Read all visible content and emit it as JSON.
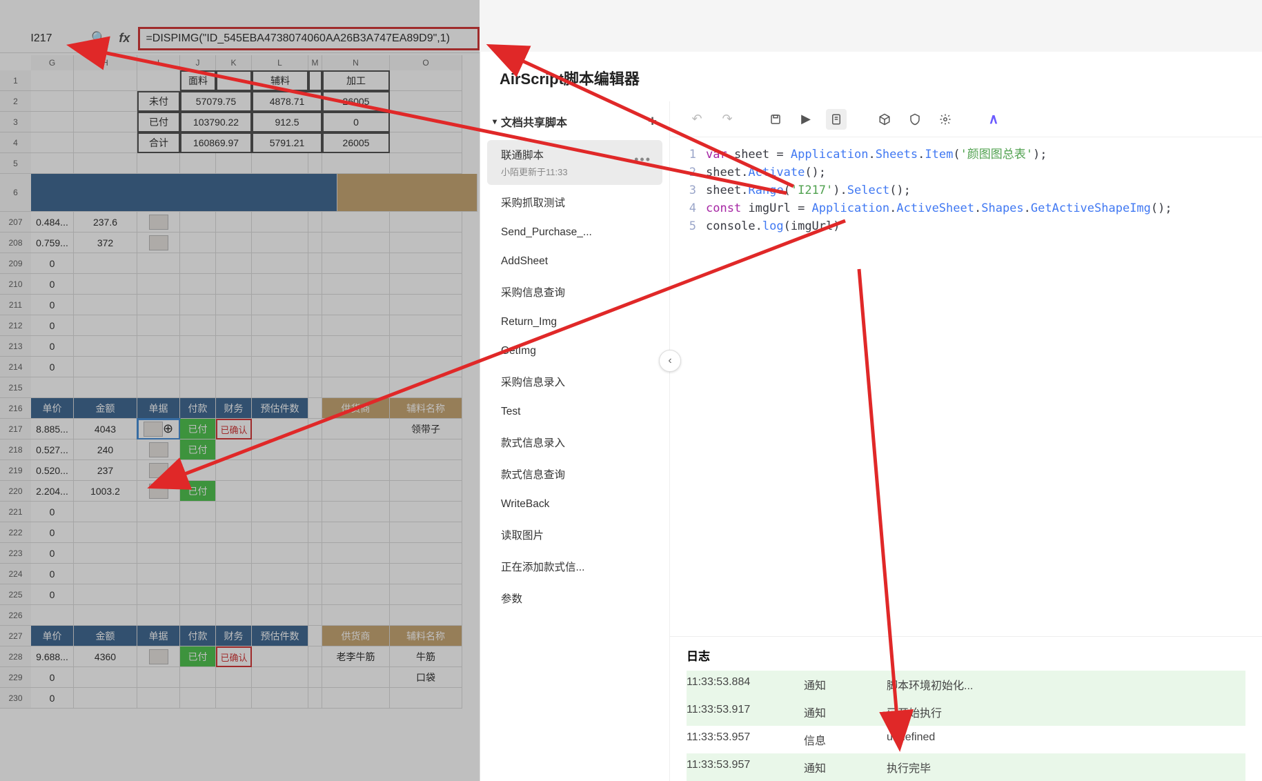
{
  "formula": {
    "cellRef": "I217",
    "value": "=DISPIMG(\"ID_545EBA4738074060AA26B3A747EA89D9\",1)"
  },
  "colHeaders": [
    "G",
    "H",
    "I",
    "J",
    "K",
    "L",
    "M",
    "N",
    "O"
  ],
  "topTable": {
    "hdr": [
      "面料",
      "辅料",
      "加工"
    ],
    "rows": [
      {
        "label": "未付",
        "vals": [
          "57079.75",
          "4878.71",
          "26005"
        ]
      },
      {
        "label": "已付",
        "vals": [
          "103790.22",
          "912.5",
          "0"
        ]
      },
      {
        "label": "合计",
        "vals": [
          "160869.97",
          "5791.21",
          "26005"
        ]
      }
    ]
  },
  "rowsA": {
    "nums": [
      "207",
      "208",
      "209",
      "210",
      "211",
      "212",
      "213",
      "214",
      "215"
    ],
    "data": [
      [
        "0.484...",
        "237.6",
        "img"
      ],
      [
        "0.759...",
        "372",
        "img"
      ],
      [
        "0",
        "",
        "",
        ""
      ],
      [
        "0",
        "",
        "",
        ""
      ],
      [
        "0",
        "",
        "",
        ""
      ],
      [
        "0",
        "",
        "",
        ""
      ],
      [
        "0",
        "",
        "",
        ""
      ],
      [
        "0",
        "",
        "",
        ""
      ],
      [
        "",
        "",
        "",
        ""
      ]
    ]
  },
  "section1": {
    "hdrRow": "216",
    "hdr": [
      "单价",
      "金额",
      "单据",
      "付款",
      "财务",
      "预估件数",
      "",
      "供货商",
      "辅料名称"
    ],
    "rows": [
      {
        "n": "217",
        "cells": [
          "8.885...",
          "4043",
          "img-sel",
          "已付",
          "已确认",
          "",
          "",
          "",
          "领带子"
        ]
      },
      {
        "n": "218",
        "cells": [
          "0.527...",
          "240",
          "img",
          "已付",
          "",
          "",
          "",
          "",
          ""
        ]
      },
      {
        "n": "219",
        "cells": [
          "0.520...",
          "237",
          "img",
          "",
          "",
          "",
          "",
          "",
          ""
        ]
      },
      {
        "n": "220",
        "cells": [
          "2.204...",
          "1003.2",
          "img",
          "已付",
          "",
          "",
          "",
          "",
          ""
        ]
      },
      {
        "n": "221",
        "cells": [
          "0",
          "",
          "",
          "",
          "",
          "",
          "",
          "",
          ""
        ]
      },
      {
        "n": "222",
        "cells": [
          "0",
          "",
          "",
          "",
          "",
          "",
          "",
          "",
          ""
        ]
      },
      {
        "n": "223",
        "cells": [
          "0",
          "",
          "",
          "",
          "",
          "",
          "",
          "",
          ""
        ]
      },
      {
        "n": "224",
        "cells": [
          "0",
          "",
          "",
          "",
          "",
          "",
          "",
          "",
          ""
        ]
      },
      {
        "n": "225",
        "cells": [
          "0",
          "",
          "",
          "",
          "",
          "",
          "",
          "",
          ""
        ]
      },
      {
        "n": "226",
        "cells": [
          "",
          "",
          "",
          "",
          "",
          "",
          "",
          "",
          ""
        ]
      }
    ]
  },
  "section2": {
    "hdrRow": "227",
    "hdr": [
      "单价",
      "金额",
      "单据",
      "付款",
      "财务",
      "预估件数",
      "",
      "供货商",
      "辅料名称"
    ],
    "rows": [
      {
        "n": "228",
        "cells": [
          "9.688...",
          "4360",
          "img",
          "已付",
          "已确认",
          "",
          "",
          "老李牛筋",
          "牛筋"
        ]
      },
      {
        "n": "229",
        "cells": [
          "0",
          "",
          "",
          "",
          "",
          "",
          "",
          "",
          "口袋"
        ]
      },
      {
        "n": "230",
        "cells": [
          "0",
          "",
          "",
          "",
          "",
          "",
          "",
          "",
          ""
        ]
      }
    ]
  },
  "panel": {
    "title": "AirScript脚本编辑器",
    "sidebarHeader": "文档共享脚本",
    "activeScript": {
      "name": "联通脚本",
      "sub": "小陌更新于11:33"
    },
    "scripts": [
      "采购抓取测试",
      "Send_Purchase_...",
      "AddSheet",
      "采购信息查询",
      "Return_Img",
      "GetImg",
      "采购信息录入",
      "Test",
      "款式信息录入",
      "款式信息查询",
      "WriteBack",
      "读取图片",
      "正在添加款式信...",
      "参数"
    ],
    "code": {
      "lines": [
        "1",
        "2",
        "3",
        "4",
        "5"
      ],
      "l1": {
        "a": "var",
        "b": " sheet = ",
        "c": "Application",
        "d": ".",
        "e": "Sheets",
        "f": ".",
        "g": "Item",
        "h": "(",
        "i": "'颜图图总表'",
        "j": ");"
      },
      "l2": {
        "a": "sheet.",
        "b": "Activate",
        "c": "();"
      },
      "l3": {
        "a": "sheet.",
        "b": "Range",
        "c": "(",
        "d": "'I217'",
        "e": ").",
        "f": "Select",
        "g": "();"
      },
      "l4": {
        "a": "const",
        "b": " imgUrl = ",
        "c": "Application",
        "d": ".",
        "e": "ActiveSheet",
        "f": ".",
        "g": "Shapes",
        "h": ".",
        "i": "GetActiveShapeImg",
        "j": "();"
      },
      "l5": {
        "a": "console.",
        "b": "log",
        "c": "(imgUrl)"
      }
    },
    "logTitle": "日志",
    "logs": [
      {
        "t": "11:33:53.884",
        "type": "通知",
        "msg": "脚本环境初始化...",
        "ok": true
      },
      {
        "t": "11:33:53.917",
        "type": "通知",
        "msg": "已开始执行",
        "ok": true
      },
      {
        "t": "11:33:53.957",
        "type": "信息",
        "msg": "undefined",
        "ok": false
      },
      {
        "t": "11:33:53.957",
        "type": "通知",
        "msg": "执行完毕",
        "ok": true
      }
    ]
  }
}
